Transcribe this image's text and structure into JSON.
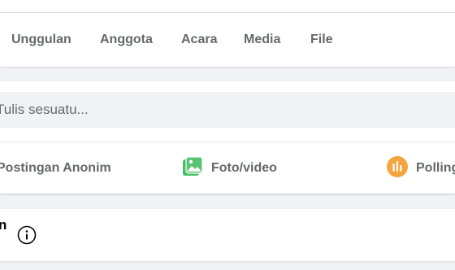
{
  "tabs": [
    {
      "label": "Unggulan"
    },
    {
      "label": "Anggota"
    },
    {
      "label": "Acara"
    },
    {
      "label": "Media"
    },
    {
      "label": "File"
    }
  ],
  "composer": {
    "placeholder": "Tulis sesuatu..."
  },
  "actions": [
    {
      "label": "Postingan Anonim",
      "icon": "anonymous-icon"
    },
    {
      "label": "Foto/video",
      "icon": "photo-video-icon",
      "color": "#45bd62"
    },
    {
      "label": "Polling",
      "icon": "poll-icon",
      "color": "#f7b928"
    }
  ],
  "about": {
    "title": "Tentang",
    "icon": "info-icon"
  },
  "colors": {
    "background": "#f0f2f5",
    "card": "#ffffff",
    "text_secondary": "#65676b",
    "photo_green": "#45bd62",
    "poll_orange": "#f5a43f"
  }
}
